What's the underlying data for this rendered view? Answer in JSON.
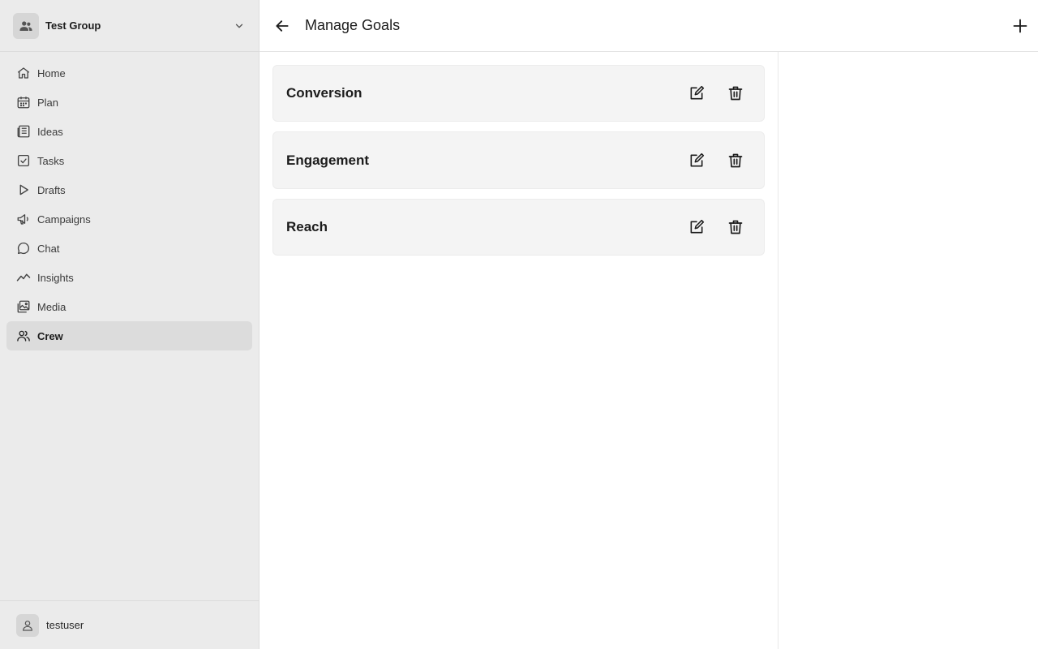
{
  "sidebar": {
    "group": {
      "name": "Test Group",
      "icon": "users-icon"
    },
    "nav": [
      {
        "id": "home",
        "label": "Home",
        "icon": "home-icon",
        "active": false
      },
      {
        "id": "plan",
        "label": "Plan",
        "icon": "calendar-icon",
        "active": false
      },
      {
        "id": "ideas",
        "label": "Ideas",
        "icon": "newspaper-icon",
        "active": false
      },
      {
        "id": "tasks",
        "label": "Tasks",
        "icon": "checkbox-icon",
        "active": false
      },
      {
        "id": "drafts",
        "label": "Drafts",
        "icon": "play-icon",
        "active": false
      },
      {
        "id": "campaigns",
        "label": "Campaigns",
        "icon": "megaphone-icon",
        "active": false
      },
      {
        "id": "chat",
        "label": "Chat",
        "icon": "chat-bubble-icon",
        "active": false
      },
      {
        "id": "insights",
        "label": "Insights",
        "icon": "trend-line-icon",
        "active": false
      },
      {
        "id": "media",
        "label": "Media",
        "icon": "images-icon",
        "active": false
      },
      {
        "id": "crew",
        "label": "Crew",
        "icon": "users-icon",
        "active": true
      }
    ],
    "user": {
      "name": "testuser",
      "icon": "person-icon"
    }
  },
  "header": {
    "title": "Manage Goals",
    "back_icon": "arrow-left-icon",
    "add_icon": "plus-icon"
  },
  "goals": [
    {
      "name": "Conversion"
    },
    {
      "name": "Engagement"
    },
    {
      "name": "Reach"
    }
  ],
  "colors": {
    "sidebar_bg": "#ebebeb",
    "active_item_bg": "#dcdcdc",
    "card_bg": "#f4f4f4",
    "text": "#1c1c1c"
  }
}
